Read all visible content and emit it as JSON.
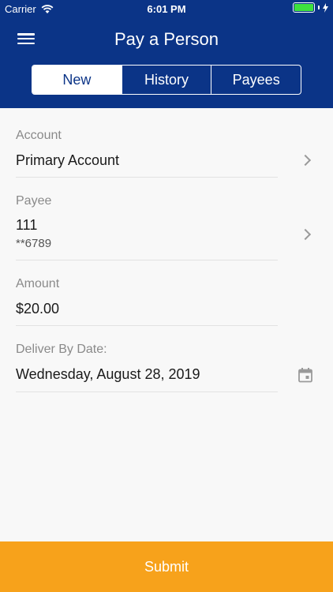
{
  "status_bar": {
    "carrier": "Carrier",
    "time": "6:01 PM"
  },
  "header": {
    "title": "Pay a Person"
  },
  "tabs": [
    {
      "label": "New"
    },
    {
      "label": "History"
    },
    {
      "label": "Payees"
    }
  ],
  "form": {
    "account": {
      "label": "Account",
      "value": "Primary Account"
    },
    "payee": {
      "label": "Payee",
      "value": "111",
      "sub": "**6789"
    },
    "amount": {
      "label": "Amount",
      "value": "$20.00"
    },
    "deliver": {
      "label": "Deliver By Date:",
      "value": "Wednesday, August 28, 2019"
    }
  },
  "submit": {
    "label": "Submit"
  },
  "colors": {
    "header": "#0b3487",
    "submit": "#f7a21b",
    "background": "#f8f8f8"
  },
  "icons": [
    "wifi-icon",
    "battery-icon",
    "menu-icon",
    "chevron-right-icon",
    "calendar-icon"
  ]
}
